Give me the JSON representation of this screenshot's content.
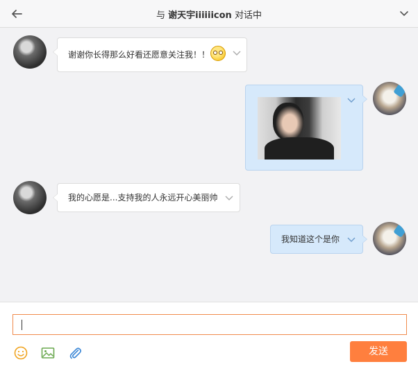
{
  "header": {
    "title_prefix": "与",
    "contact_name": "谢天宇iiiiiicon",
    "title_suffix": "对话中"
  },
  "messages": [
    {
      "sender": "other",
      "text": "谢谢你长得那么好看还愿意关注我！！",
      "has_emoji": true
    },
    {
      "sender": "me",
      "type": "image"
    },
    {
      "sender": "other",
      "text": "我的心愿是...支持我的人永远开心美丽帅"
    },
    {
      "sender": "me",
      "text": "我知道这个是你"
    }
  ],
  "composer": {
    "input_value": "",
    "send_label": "发送"
  },
  "colors": {
    "accent": "#ff7f3e",
    "sent_bubble": "#d6e9fb",
    "received_bubble": "#ffffff",
    "icon_tint": "#f0a31e"
  }
}
